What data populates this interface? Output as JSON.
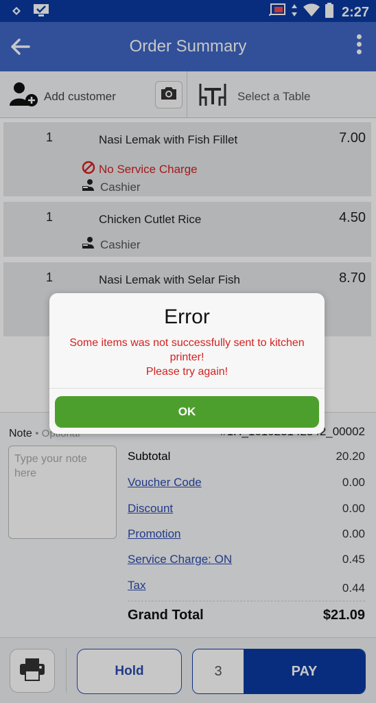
{
  "statusbar": {
    "time": "2:27"
  },
  "appbar": {
    "title": "Order Summary"
  },
  "customer": {
    "add_label": "Add customer",
    "table_label": "Select a Table"
  },
  "items": [
    {
      "qty": "1",
      "name": "Nasi Lemak with Fish Fillet",
      "price": "7.00",
      "service_note": "No Service Charge",
      "staff": "Cashier"
    },
    {
      "qty": "1",
      "name": "Chicken Cutlet Rice",
      "price": "4.50",
      "staff": "Cashier"
    },
    {
      "qty": "1",
      "name": "Nasi Lemak with Selar Fish",
      "price": "8.70"
    }
  ],
  "note": {
    "label": "Note",
    "optional": "• Optional",
    "placeholder": "Type your note here"
  },
  "summary": {
    "ref": "#1H_161023142342_00002",
    "subtotal_label": "Subtotal",
    "subtotal": "20.20",
    "voucher_label": "Voucher Code",
    "voucher": "0.00",
    "discount_label": "Discount",
    "discount": "0.00",
    "promotion_label": "Promotion",
    "promotion": "0.00",
    "service_label": "Service Charge: ON",
    "service": "0.45",
    "tax_label": "Tax",
    "tax": "0.44",
    "grand_label": "Grand Total",
    "grand": "$21.09"
  },
  "bottom": {
    "hold_label": "Hold",
    "count": "3",
    "pay_label": "PAY"
  },
  "dialog": {
    "title": "Error",
    "message_line1": "Some items was not successfully sent to kitchen printer!",
    "message_line2": "Please try again!",
    "ok_label": "OK"
  },
  "colors": {
    "primary": "#0b3aa3",
    "appbar": "#3f67c4",
    "error": "#d42020",
    "ok": "#4d9f2d",
    "link": "#2c4bb0"
  }
}
